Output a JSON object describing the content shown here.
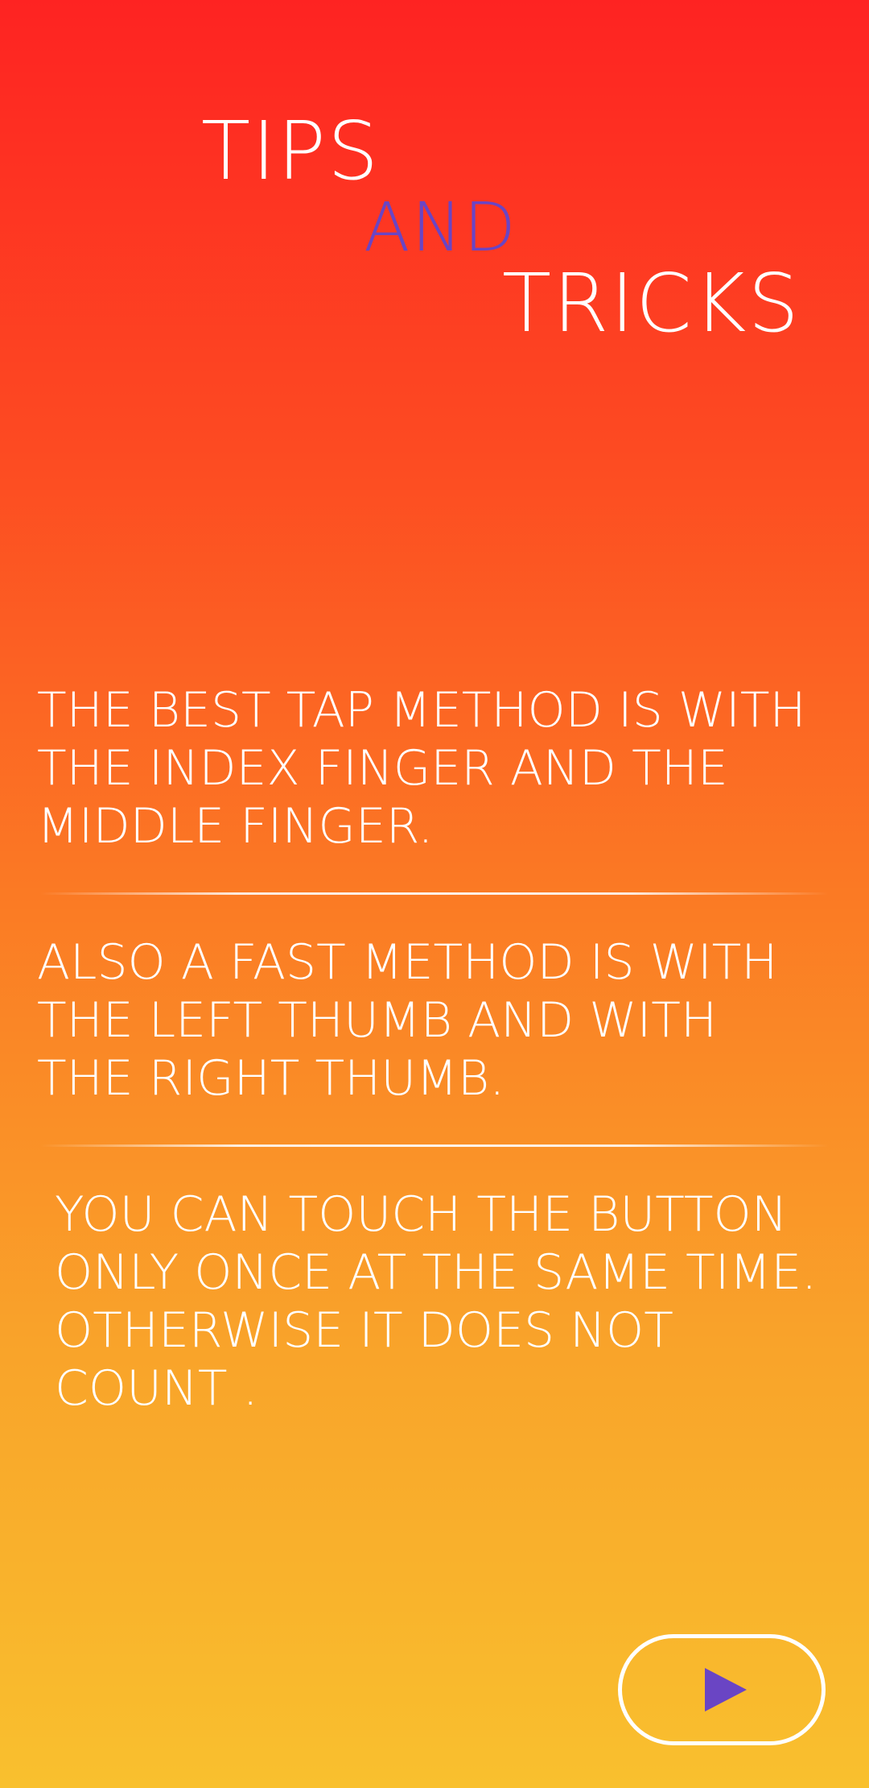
{
  "title": {
    "word_1": "TIPS",
    "word_2": "AND",
    "word_3": "TRICKS"
  },
  "tips": [
    {
      "text": "THE BEST TAP METHOD IS WITH THE INDEX FINGER AND THE MIDDLE FINGER."
    },
    {
      "text": "ALSO A FAST METHOD IS WITH THE LEFT THUMB AND WITH THE RIGHT THUMB."
    },
    {
      "text": "YOU CAN TOUCH THE BUTTON ONLY ONCE AT THE SAME TIME. OTHERWISE IT DOES NOT COUNT ."
    }
  ],
  "play_button": {
    "icon": "play-icon"
  },
  "colors": {
    "gradient_top": "#FE2322",
    "gradient_bottom": "#F9C02E",
    "accent_purple": "#6A45C4",
    "text": "#FFFFFF"
  }
}
